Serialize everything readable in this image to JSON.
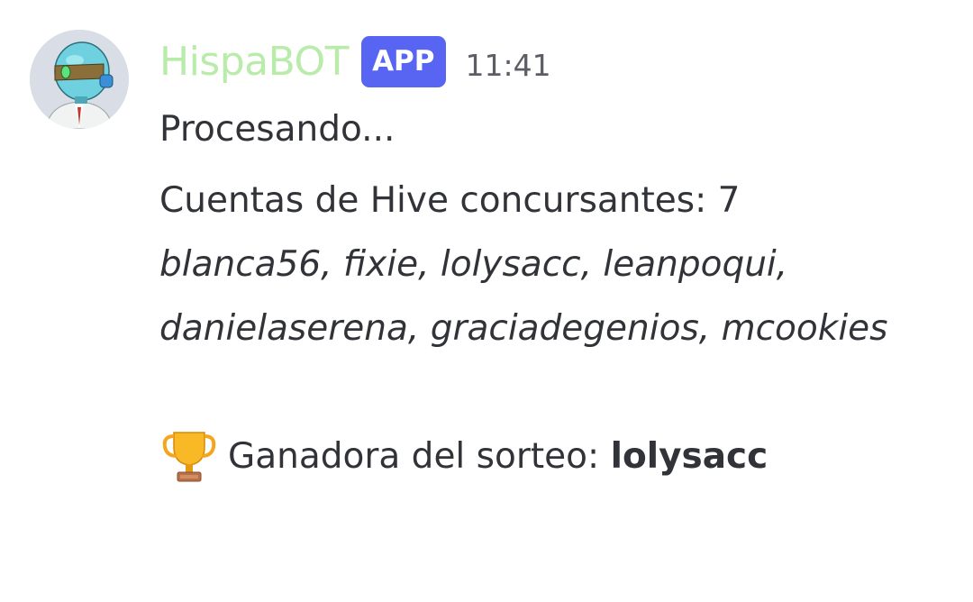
{
  "message": {
    "author": "HispaBOT",
    "badge": "APP",
    "timestamp": "11:41",
    "author_color": "#b9ecaa",
    "badge_color": "#5865f2",
    "avatar_icon": "robot-avatar",
    "status_line": "Procesando...",
    "contestants_label": "Cuentas de Hive concursantes: 7",
    "contestants": [
      "blanca56",
      "fixie",
      "lolysacc",
      "leanpoqui",
      "danielaserena",
      "graciadegenios",
      "mcookies"
    ],
    "contestants_text": "blanca56, fixie, lolysacc, leanpoqui, danielaserena, graciadegenios, mcookies",
    "winner_icon": "trophy-icon",
    "winner_label": "Ganadora del sorteo: ",
    "winner_name": "lolysacc"
  }
}
